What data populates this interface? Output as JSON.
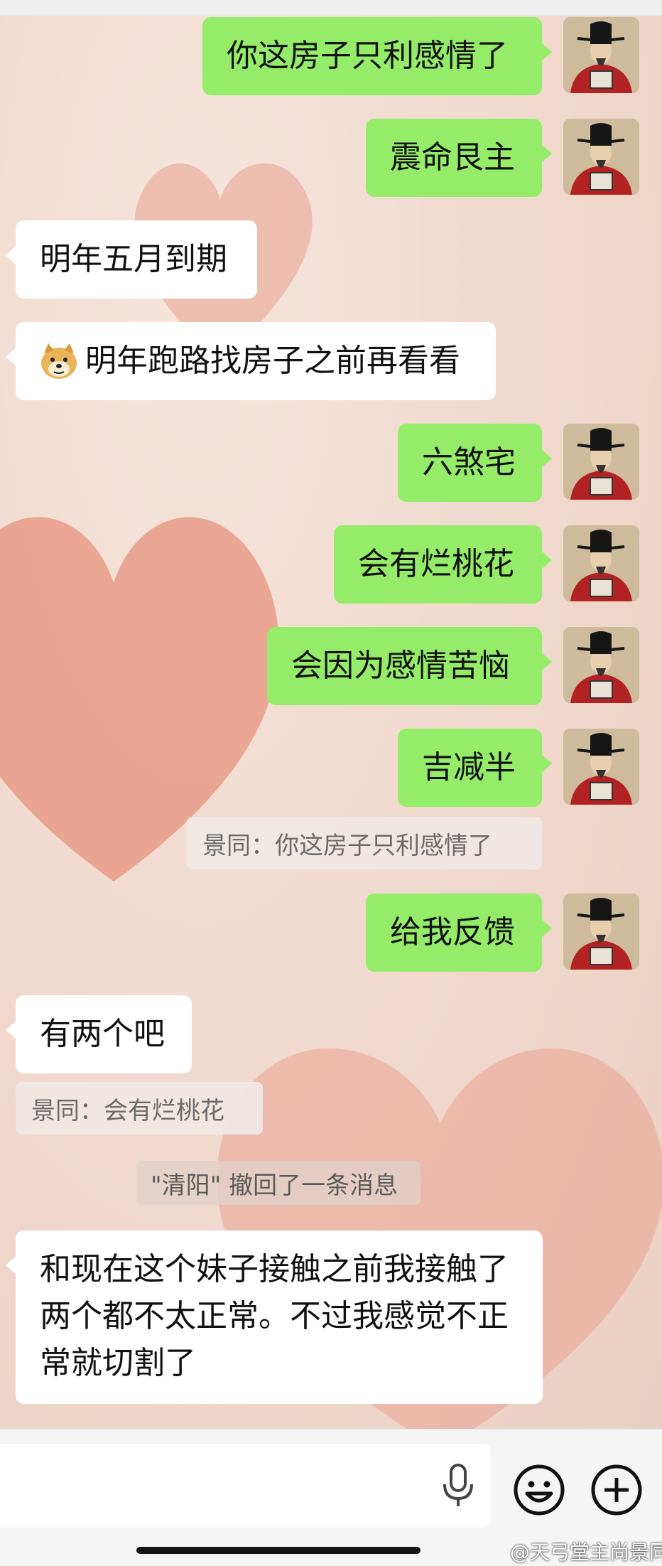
{
  "chat": {
    "messages": [
      {
        "from": "me",
        "text": "你这房子只利感情了"
      },
      {
        "from": "me",
        "text": "震命艮主"
      },
      {
        "from": "other",
        "text": "明年五月到期"
      },
      {
        "from": "other",
        "emoji": "doge-emoji",
        "text": "明年跑路找房子之前再看看"
      },
      {
        "from": "me",
        "text": "六煞宅"
      },
      {
        "from": "me",
        "text": "会有烂桃花"
      },
      {
        "from": "me",
        "text": "会因为感情苦恼"
      },
      {
        "from": "me",
        "text": "吉减半"
      },
      {
        "type": "quote",
        "side": "me",
        "text": "景同：你这房子只利感情了"
      },
      {
        "from": "me",
        "text": "给我反馈"
      },
      {
        "from": "other",
        "text": "有两个吧"
      },
      {
        "type": "quote",
        "side": "other",
        "text": "景同：会有烂桃花"
      },
      {
        "type": "system",
        "text": "\"清阳\" 撤回了一条消息"
      },
      {
        "from": "other",
        "text": "和现在这个妹子接触之前我接触了两个都不太正常。不过我感觉不正常就切割了"
      }
    ]
  },
  "input_bar": {
    "mic_icon": "microphone-icon",
    "emoji_icon": "smiley-face-icon",
    "plus_icon": "plus-circle-icon"
  },
  "watermark": "@天弓堂主尚景同",
  "colors": {
    "my_bubble": "#95ec69",
    "other_bubble": "#ffffff",
    "background": "#f1ddd2",
    "heart": "#e89480"
  }
}
